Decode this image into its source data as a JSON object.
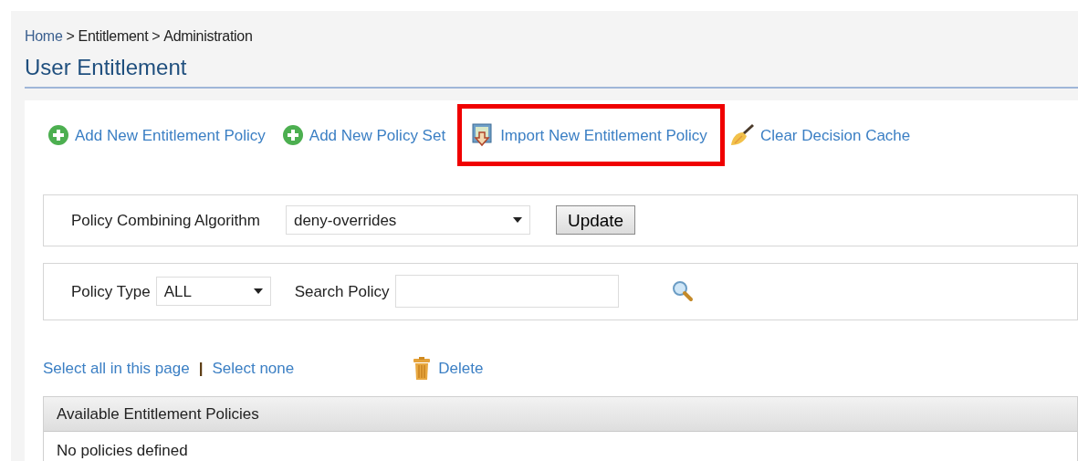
{
  "breadcrumb": [
    {
      "kind": "link",
      "label": "Home"
    },
    {
      "kind": "separator",
      "label": ">"
    },
    {
      "kind": "text",
      "label": "Entitlement"
    },
    {
      "kind": "separator",
      "label": ">"
    },
    {
      "kind": "text",
      "label": "Administration"
    }
  ],
  "page_title": "User Entitlement",
  "actions": [
    {
      "kind": "add",
      "label": "Add New Entitlement Policy",
      "highlighted": false
    },
    {
      "kind": "add",
      "label": "Add New Policy Set",
      "highlighted": false
    },
    {
      "kind": "import",
      "label": "Import New Entitlement Policy",
      "highlighted": true
    },
    {
      "kind": "clear",
      "label": "Clear Decision Cache",
      "highlighted": false
    }
  ],
  "algorithm": {
    "label": "Policy Combining Algorithm",
    "value": "deny-overrides",
    "button": "Update"
  },
  "filter": {
    "type_label": "Policy Type",
    "type_value": "ALL",
    "search_label": "Search Policy"
  },
  "selection": {
    "select_all": "Select all in this page",
    "separator": "|",
    "select_none": "Select none",
    "delete": "Delete"
  },
  "table": {
    "columns": [
      "Available Entitlement Policies"
    ],
    "empty_message": "No policies defined"
  }
}
